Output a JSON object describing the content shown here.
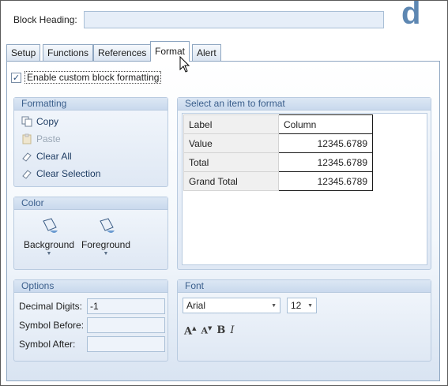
{
  "header": {
    "block_heading_label": "Block Heading:",
    "block_heading_value": "",
    "brand_letter": "d"
  },
  "tabs": [
    {
      "label": "Setup"
    },
    {
      "label": "Functions"
    },
    {
      "label": "References"
    },
    {
      "label": "Format",
      "active": true
    },
    {
      "label": "Alert"
    }
  ],
  "enable_custom": {
    "label": "Enable custom block formatting",
    "checked": true
  },
  "formatting": {
    "title": "Formatting",
    "copy": "Copy",
    "paste": "Paste",
    "clear_all": "Clear All",
    "clear_selection": "Clear Selection"
  },
  "color": {
    "title": "Color",
    "background": "Background",
    "foreground": "Foreground"
  },
  "options": {
    "title": "Options",
    "decimal_digits_label": "Decimal Digits:",
    "decimal_digits_value": "-1",
    "symbol_before_label": "Symbol Before:",
    "symbol_before_value": "",
    "symbol_after_label": "Symbol After:",
    "symbol_after_value": ""
  },
  "select_item": {
    "title": "Select an item to format",
    "rows": [
      {
        "label": "Label",
        "value": "Column"
      },
      {
        "label": "Value",
        "value": "12345.6789"
      },
      {
        "label": "Total",
        "value": "12345.6789"
      },
      {
        "label": "Grand Total",
        "value": "12345.6789"
      }
    ]
  },
  "font": {
    "title": "Font",
    "family": "Arial",
    "size": "12",
    "buttons": [
      "grow-font",
      "shrink-font",
      "bold",
      "italic"
    ]
  },
  "colors": {
    "accent": "#5d87b2",
    "group_title": "#3b5f8c"
  }
}
